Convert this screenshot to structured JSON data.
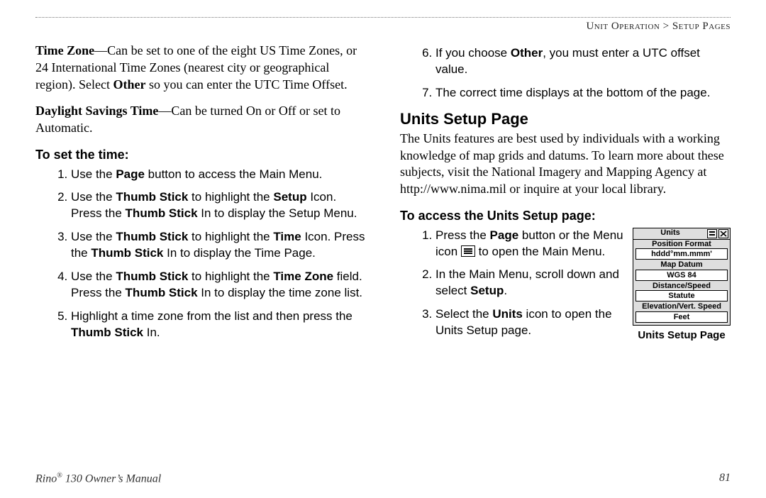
{
  "breadcrumb": {
    "section": "Unit Operation",
    "sep": " > ",
    "page": "Setup Pages"
  },
  "left": {
    "tz": {
      "label": "Time Zone",
      "dash": "—",
      "text1": "Can be set to one of the eight US Time Zones, or 24 International Time Zones (nearest city or geographical region). Select ",
      "bold": "Other",
      "text2": " so you can enter the UTC Time Offset."
    },
    "dst": {
      "label": "Daylight Savings Time",
      "dash": "—",
      "text": "Can be turned On or Off or set to Automatic."
    },
    "setTimeHeading": "To set the time:",
    "steps": {
      "s1a": "Use the ",
      "s1b": "Page",
      "s1c": " button to access the Main Menu.",
      "s2a": "Use the ",
      "s2b": "Thumb Stick",
      "s2c": " to highlight the ",
      "s2d": "Setup",
      "s2e": " Icon. Press the ",
      "s2f": "Thumb Stick",
      "s2g": " In to display the Setup Menu.",
      "s3a": "Use the ",
      "s3b": "Thumb Stick",
      "s3c": " to highlight the ",
      "s3d": "Time",
      "s3e": " Icon. Press the ",
      "s3f": "Thumb Stick",
      "s3g": " In to display the Time Page.",
      "s4a": "Use the ",
      "s4b": "Thumb Stick",
      "s4c": " to highlight the ",
      "s4d": "Time Zone",
      "s4e": " field. Press the ",
      "s4f": "Thumb Stick",
      "s4g": " In to display the time zone list.",
      "s5a": "Highlight a time zone from the list and then press the ",
      "s5b": "Thumb Stick",
      "s5c": " In."
    }
  },
  "right": {
    "steps": {
      "s6a": "If you choose ",
      "s6b": "Other",
      "s6c": ", you must enter a UTC offset value.",
      "s7": "The correct time displays at the bottom of the page."
    },
    "unitsHeading": "Units Setup Page",
    "unitsPara": "The Units features are best used by individuals with a working knowledge of map grids and datums. To learn more about these subjects, visit the National Imagery and Mapping Agency at http://www.nima.mil or inquire at your local library.",
    "accessHeading": "To access the Units Setup page:",
    "access": {
      "s1a": "Press the ",
      "s1b": "Page",
      "s1c": " button or the Menu icon ",
      "s1d": " to open the Main Menu.",
      "s2a": "In the Main Menu, scroll down and select ",
      "s2b": "Setup",
      "s2c": ".",
      "s3a": "Select the ",
      "s3b": "Units",
      "s3c": " icon to open the Units Setup page."
    },
    "figure": {
      "title": "Units",
      "rows": [
        {
          "label": "Position Format",
          "value": "hddd°mm.mmm'"
        },
        {
          "label": "Map Datum",
          "value": "WGS 84"
        },
        {
          "label": "Distance/Speed",
          "value": "Statute"
        },
        {
          "label": "Elevation/Vert. Speed",
          "value": "Feet"
        }
      ],
      "caption": "Units Setup Page"
    }
  },
  "footer": {
    "manual_a": "Rino",
    "manual_reg": "®",
    "manual_b": " 130 Owner’s Manual",
    "pageNum": "81"
  }
}
